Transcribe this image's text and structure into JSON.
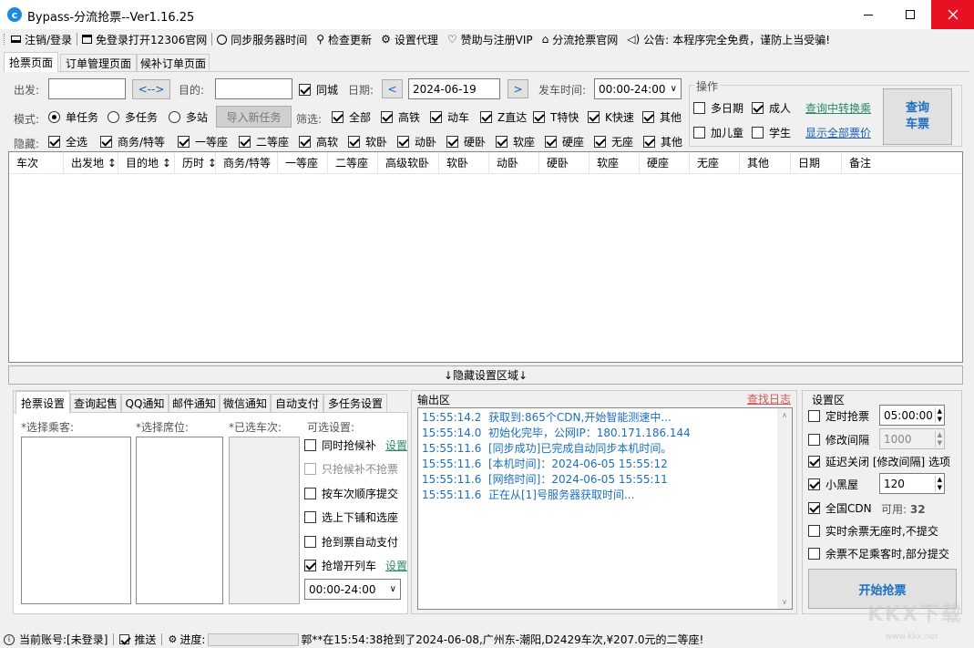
{
  "window": {
    "title": "Bypass-分流抢票--Ver1.16.25"
  },
  "toolbar": {
    "items": [
      {
        "icon": "monitor-icon",
        "label": "注销/登录"
      },
      {
        "icon": "window-icon",
        "label": "免登录打开12306官网"
      },
      {
        "icon": "clock-icon",
        "label": "同步服务器时间"
      },
      {
        "icon": "search-icon",
        "label": "检查更新"
      },
      {
        "icon": "gear-icon",
        "label": "设置代理"
      },
      {
        "icon": "heart-icon",
        "label": "赞助与注册VIP"
      },
      {
        "icon": "home-icon",
        "label": "分流抢票官网"
      },
      {
        "icon": "speaker-icon",
        "label": "公告:"
      }
    ],
    "notice": "本程序完全免费，谨防上当受骗!"
  },
  "tabs": [
    "抢票页面",
    "订单管理页面",
    "候补订单页面"
  ],
  "query": {
    "from_label": "出发:",
    "from_value": "",
    "swap": "<-->",
    "to_label": "目的:",
    "to_value": "",
    "same_city": "同城",
    "date_label": "日期:",
    "date": "2024-06-19",
    "time_label": "发车时间:",
    "time": "00:00-24:00"
  },
  "mode": {
    "label": "模式:",
    "options": [
      "单任务",
      "多任务",
      "多站"
    ],
    "import_btn": "导入新任务"
  },
  "filter": {
    "label": "筛选:",
    "items": [
      "全部",
      "高铁",
      "动车",
      "Z直达",
      "T特快",
      "K快速",
      "其他"
    ]
  },
  "hide": {
    "label": "隐藏:",
    "items": [
      "全选",
      "商务/特等",
      "一等座",
      "二等座",
      "高软",
      "软卧",
      "动卧",
      "硬卧",
      "软座",
      "硬座",
      "无座",
      "其他"
    ]
  },
  "ops": {
    "title": "操作",
    "multi_date": "多日期",
    "adult": "成人",
    "transfer": "查询中转换乘",
    "child": "加儿童",
    "student": "学生",
    "show_prices": "显示全部票价",
    "query_btn": "查询\n车票"
  },
  "table": {
    "headers": [
      "车次",
      "出发地 ↕",
      "目的地 ↕",
      "历时 ↕",
      "商务/特等",
      "一等座",
      "二等座",
      "高级软卧",
      "软卧",
      "动卧",
      "硬卧",
      "软座",
      "硬座",
      "无座",
      "其他",
      "日期",
      "备注"
    ]
  },
  "hide_area": "↓隐藏设置区域↓",
  "left_tabs": [
    "抢票设置",
    "查询起售",
    "QQ通知",
    "邮件通知",
    "微信通知",
    "自动支付",
    "多任务设置"
  ],
  "settings": {
    "passenger": "*选择乘客:",
    "seat": "*选择席位:",
    "train": "*已选车次:",
    "optional": "可选设置:",
    "options": [
      {
        "label": "同时抢候补",
        "link": "设置"
      },
      {
        "label": "只抢候补不抢票",
        "link": ""
      },
      {
        "label": "按车次顺序提交",
        "link": ""
      },
      {
        "label": "选上下铺和选座",
        "link": ""
      },
      {
        "label": "抢到票自动支付",
        "link": ""
      },
      {
        "label": "抢增开列车",
        "link": "设置"
      }
    ],
    "time": "00:00-24:00"
  },
  "output": {
    "title": "输出区",
    "find_log": "查找日志",
    "lines": [
      "15:55:14.2  获取到:865个CDN,开始智能测速中...",
      "15:55:14.0  初始化完毕，公网IP：180.171.186.144",
      "15:55:11.6  [同步成功]已完成自动同步本机时间。",
      "15:55:11.6  [本机时间]：2024-06-05 15:55:12",
      "15:55:11.6  [网络时间]：2024-06-05 15:55:11",
      "15:55:11.6  正在从[1]号服务器获取时间..."
    ]
  },
  "setup": {
    "title": "设置区",
    "timed": "定时抢票",
    "timed_val": "05:00:00",
    "interval": "修改间隔",
    "interval_val": "1000",
    "delay": "延迟关闭 [修改间隔] 选项",
    "blackroom": "小黑屋",
    "blackroom_val": "120",
    "cdn": "全国CDN",
    "cdn_avail": "可用: ",
    "cdn_count": "32",
    "no_seat": "实时余票无座时,不提交",
    "partial": "余票不足乘客时,部分提交",
    "start_btn": "开始抢票"
  },
  "status": {
    "account": "当前账号:[未登录]",
    "push": "推送",
    "progress": "进度:",
    "ticker": "郭**在15:54:38抢到了2024-06-08,广州东-潮阳,D2429车次,¥207.0元的二等座!"
  },
  "watermark": "KKX下载",
  "watermark_url": "www.kkx.net"
}
